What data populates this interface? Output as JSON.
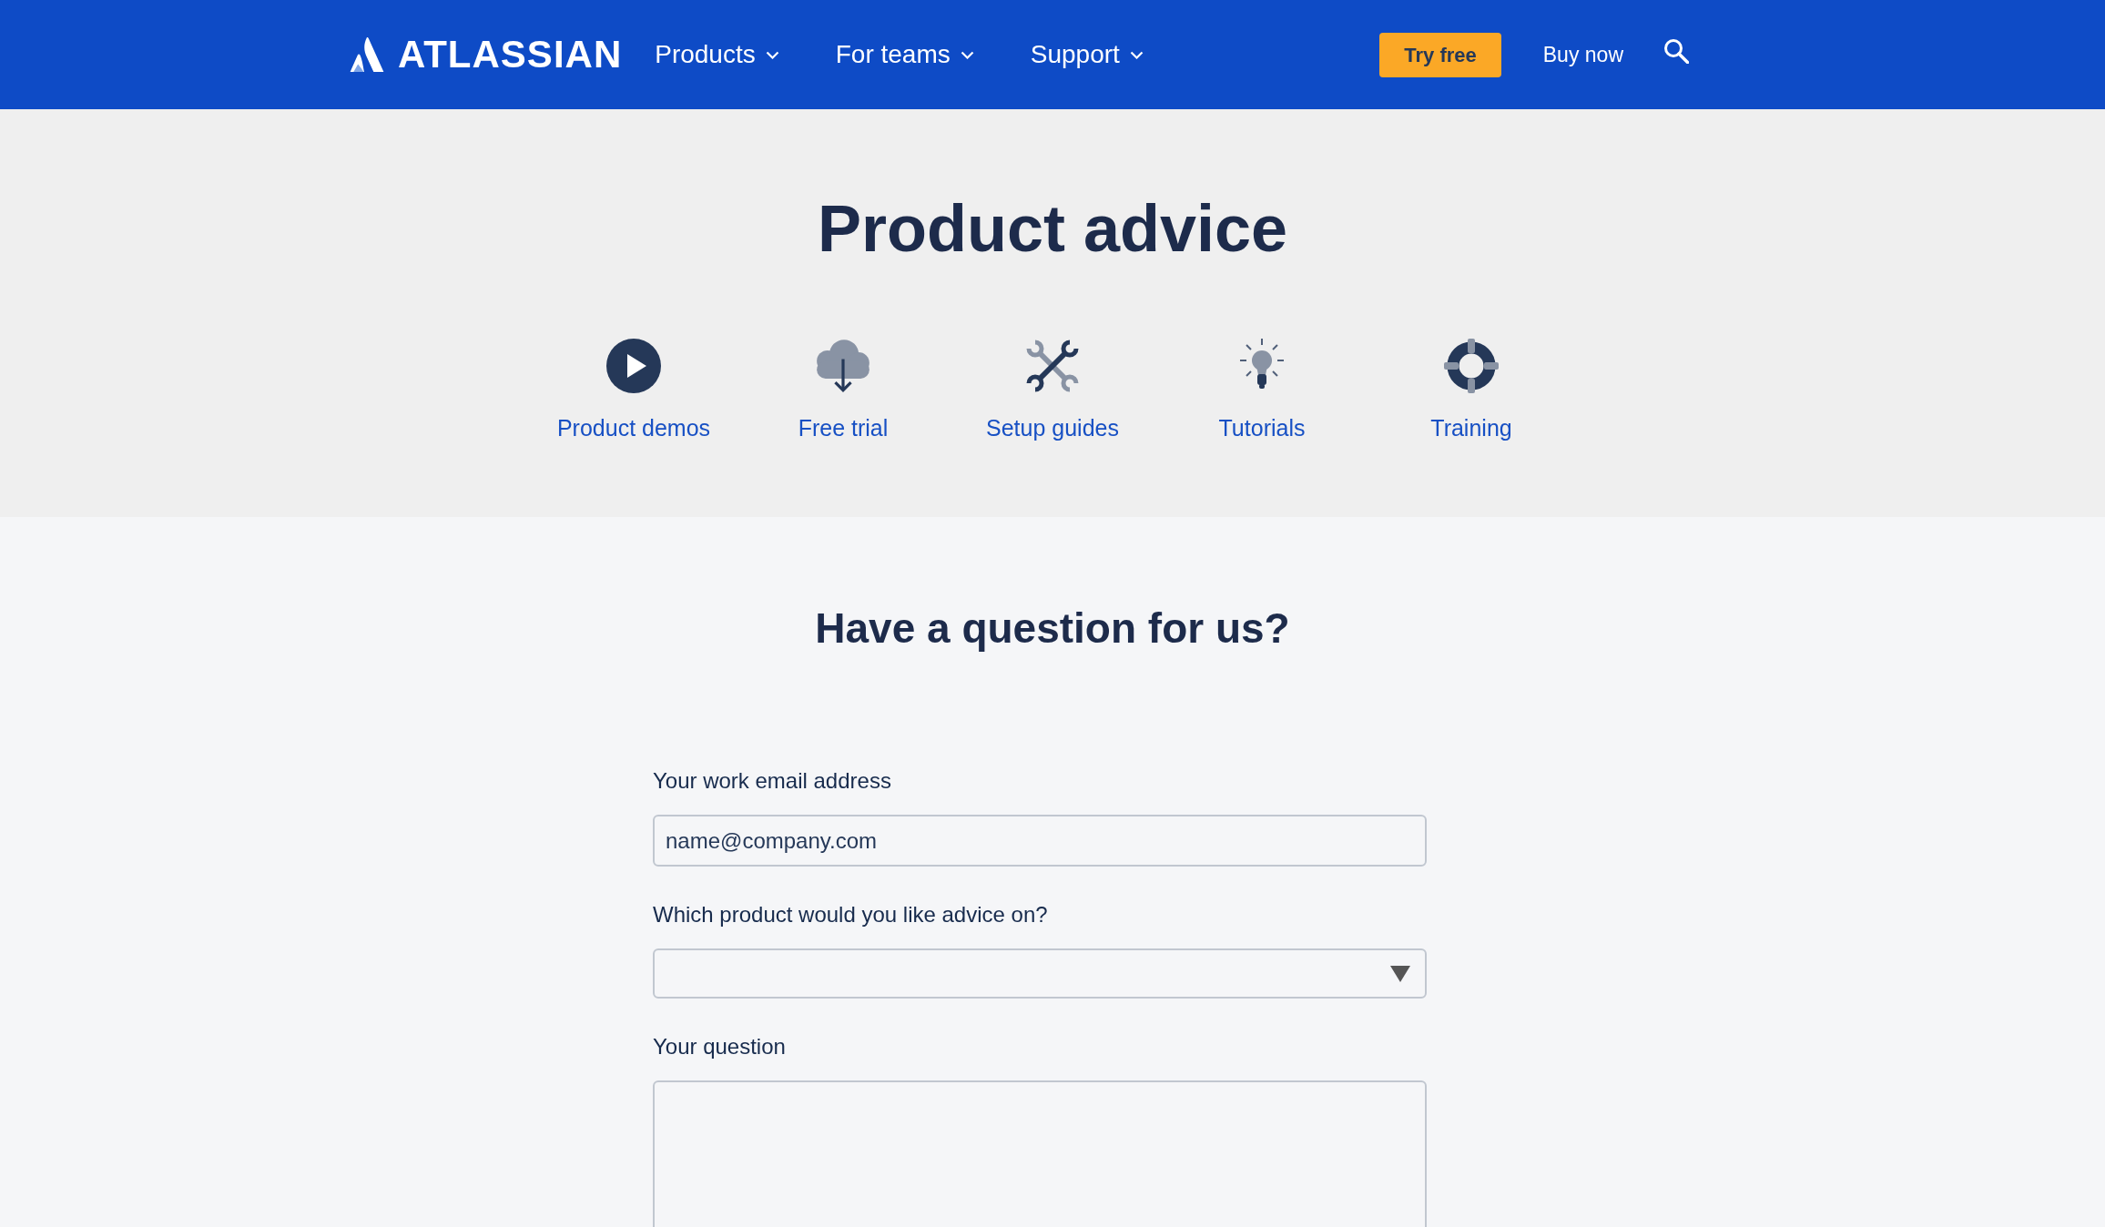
{
  "header": {
    "logo": {
      "text": "ATLASSIAN"
    },
    "nav": [
      {
        "label": "Products"
      },
      {
        "label": "For teams"
      },
      {
        "label": "Support"
      }
    ],
    "try_button": "Try free",
    "buy_link": "Buy now"
  },
  "hero": {
    "title": "Product advice",
    "links": [
      {
        "label": "Product demos",
        "kind": "play"
      },
      {
        "label": "Free trial",
        "kind": "cloud"
      },
      {
        "label": "Setup guides",
        "kind": "tools"
      },
      {
        "label": "Tutorials",
        "kind": "bulb"
      },
      {
        "label": "Training",
        "kind": "lifebuoy"
      }
    ]
  },
  "form": {
    "title": "Have a question for us?",
    "fields": [
      {
        "kind": "input",
        "label": "Your work email address",
        "placeholder": "name@company.com"
      },
      {
        "kind": "select",
        "label": "Which product would you like advice on?"
      },
      {
        "kind": "textarea",
        "label": "Your question"
      }
    ]
  }
}
